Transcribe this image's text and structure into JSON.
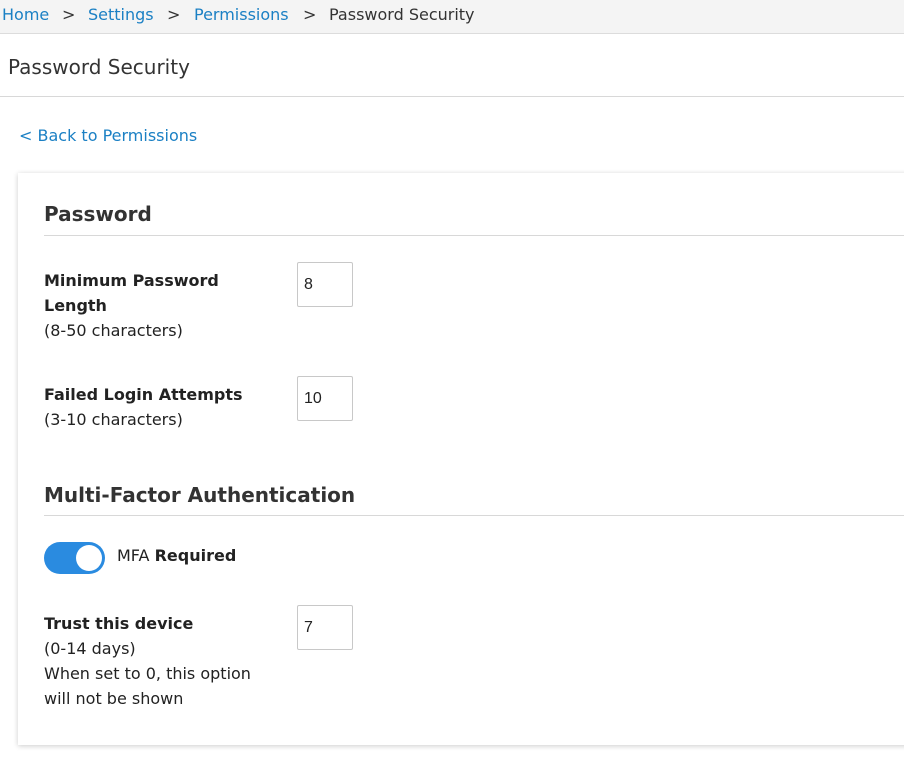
{
  "breadcrumb": {
    "items": [
      {
        "label": "Home"
      },
      {
        "label": "Settings"
      },
      {
        "label": "Permissions"
      }
    ],
    "current": "Password Security",
    "separator": ">"
  },
  "page": {
    "title": "Password Security",
    "back_link": "< Back to Permissions"
  },
  "password_section": {
    "title": "Password",
    "min_length": {
      "label_line1": "Minimum Password",
      "label_line2": "Length",
      "hint": "(8-50 characters)",
      "value": "8"
    },
    "failed_attempts": {
      "label": "Failed Login Attempts",
      "hint": "(3-10 characters)",
      "value": "10"
    }
  },
  "mfa_section": {
    "title": "Multi-Factor Authentication",
    "toggle": {
      "on": true,
      "label_prefix": "MFA",
      "label_bold": "Required"
    },
    "trust_device": {
      "label": "Trust this device",
      "hint": "(0-14 days)",
      "note_line1": "When set to 0, this option",
      "note_line2": "will not be shown",
      "value": "7"
    }
  },
  "colors": {
    "link": "#1b80c4",
    "toggle_on": "#2a8be0",
    "breadcrumb_bg": "#f4f4f4"
  }
}
